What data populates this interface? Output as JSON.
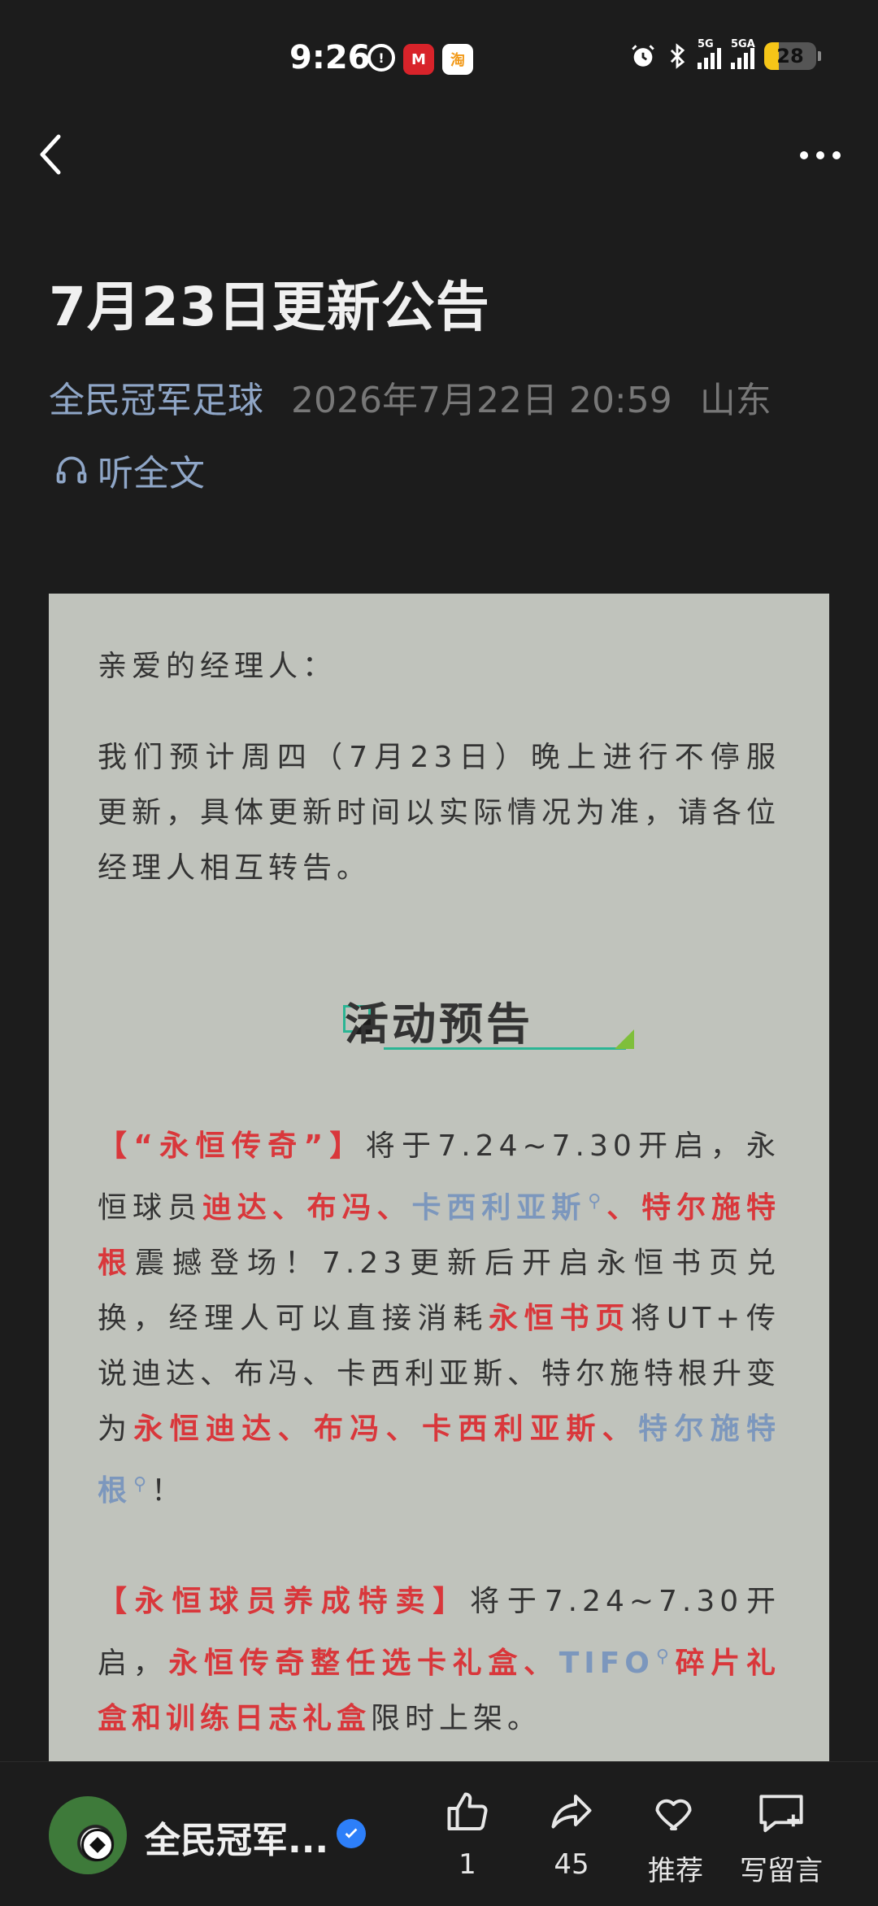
{
  "status_bar": {
    "time": "9:26",
    "app_icons": [
      "location-icon",
      "unionpay-icon",
      "taobao-icon"
    ],
    "signal1_label": "5G",
    "signal2_label": "5GA",
    "battery": "28"
  },
  "article": {
    "title": "7月23日更新公告",
    "author": "全民冠军足球",
    "datetime": "2026年7月22日 20:59",
    "location": "山东",
    "listen_label": "听全文"
  },
  "content": {
    "greeting": "亲爱的经理人：",
    "intro": "我们预计周四（7月23日）晚上进行不停服更新，具体更新时间以实际情况为准，请各位经理人相互转告。",
    "section_title": "活动预告",
    "p1": {
      "t1": "【“永恒传奇”】",
      "t2": "将于7.24~7.30开启，永恒球员",
      "t3": "迪达、布冯、",
      "t4": "卡西利亚斯",
      "t5": "、特尔施特根",
      "t6": "震撼登场！7.23更新后开启永恒书页兑换，经理人可以直接消耗",
      "t7": "永恒书页",
      "t8": "将UT+传说迪达、布冯、卡西利亚斯、特尔施特根升变为",
      "t9": "永恒迪达、布冯、卡西利亚斯、",
      "t10": "特尔施特根",
      "t11": "！"
    },
    "p2": {
      "t1": "【永恒球员养成特卖】",
      "t2": "将于7.24~7.30开启，",
      "t3": "永恒传奇整任选卡礼盒、",
      "t4": "TIFO",
      "t5": "碎片礼盒和训练日志礼盒",
      "t6": "限时上架。"
    }
  },
  "bottom_bar": {
    "account_name": "全民冠军...",
    "like_count": "1",
    "share_count": "45",
    "recommend_label": "推荐",
    "comment_label": "写留言"
  }
}
